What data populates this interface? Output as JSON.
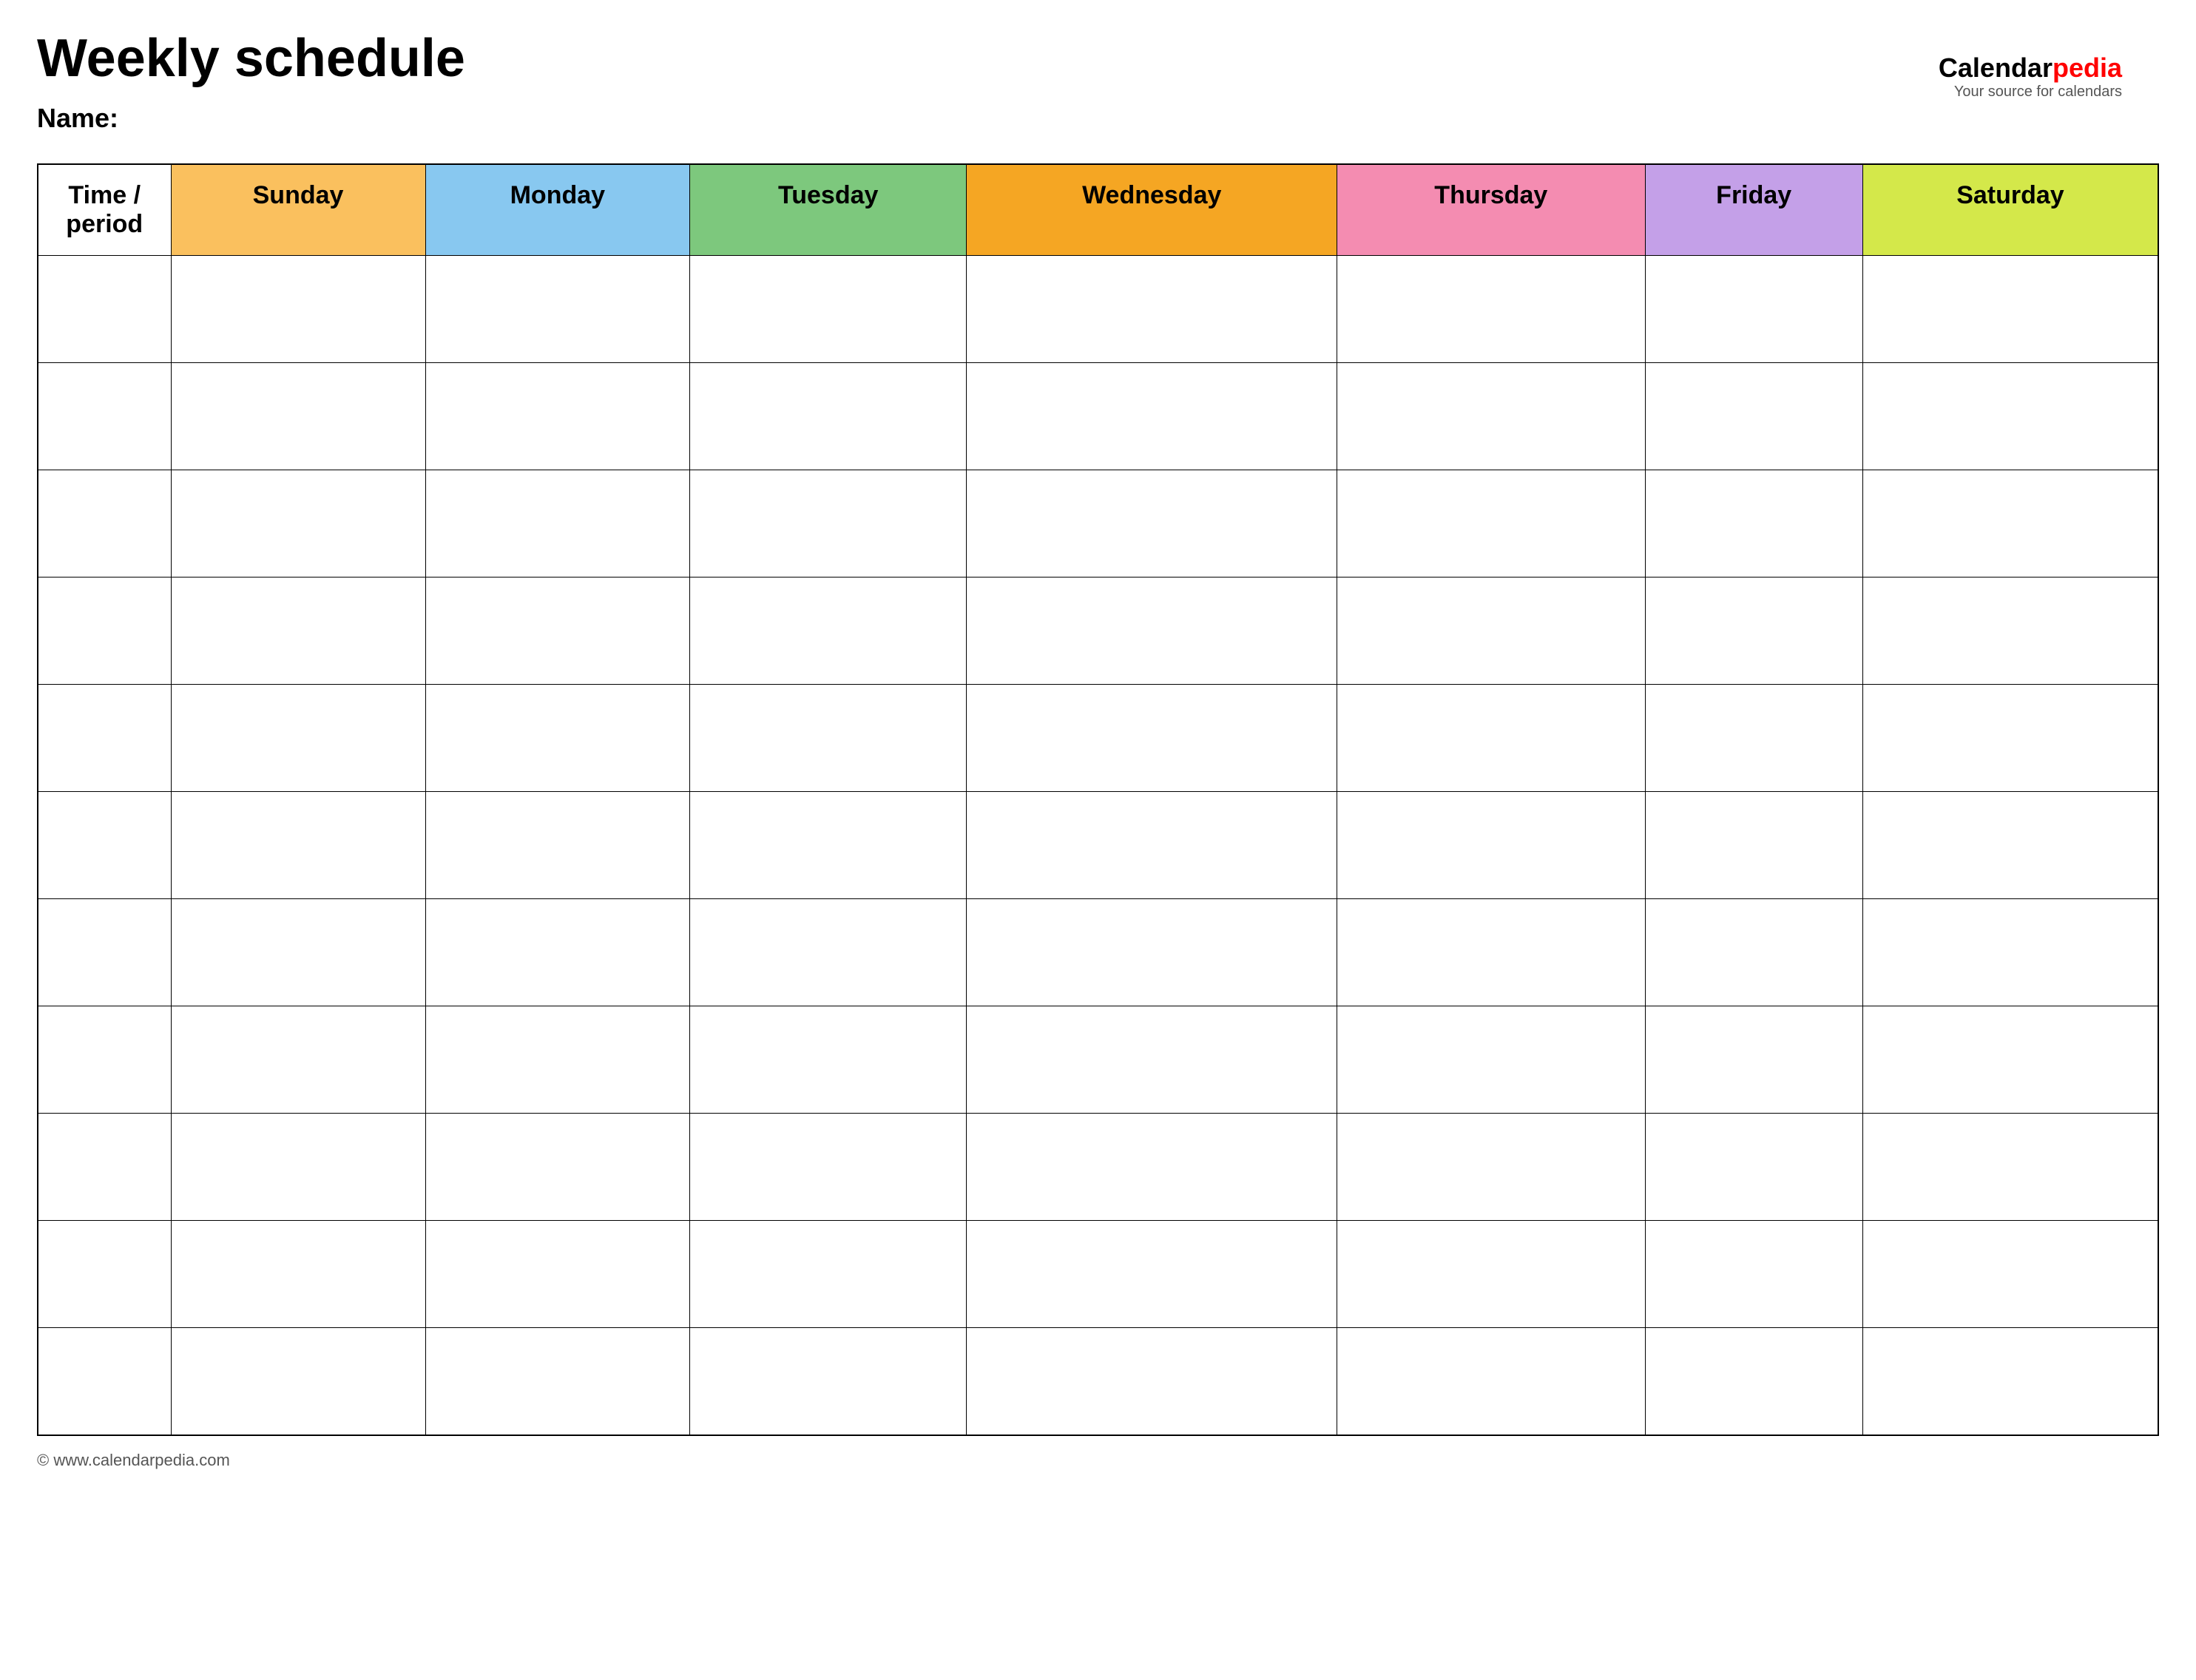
{
  "title": "Weekly schedule",
  "name_label": "Name:",
  "logo": {
    "calendar_text": "Calendar",
    "pedia_text": "pedia",
    "tagline": "Your source for calendars"
  },
  "footer": {
    "url": "© www.calendarpedia.com"
  },
  "table": {
    "headers": [
      {
        "id": "time",
        "label": "Time / period",
        "class": "th-time"
      },
      {
        "id": "sunday",
        "label": "Sunday",
        "class": "th-sunday"
      },
      {
        "id": "monday",
        "label": "Monday",
        "class": "th-monday"
      },
      {
        "id": "tuesday",
        "label": "Tuesday",
        "class": "th-tuesday"
      },
      {
        "id": "wednesday",
        "label": "Wednesday",
        "class": "th-wednesday"
      },
      {
        "id": "thursday",
        "label": "Thursday",
        "class": "th-thursday"
      },
      {
        "id": "friday",
        "label": "Friday",
        "class": "th-friday"
      },
      {
        "id": "saturday",
        "label": "Saturday",
        "class": "th-saturday"
      }
    ],
    "row_count": 11
  }
}
